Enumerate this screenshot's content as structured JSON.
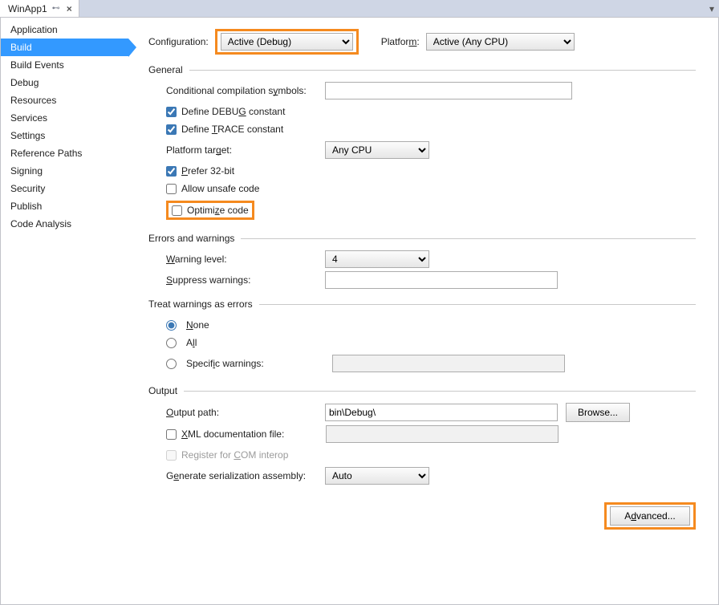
{
  "tab": {
    "title": "WinApp1"
  },
  "sidenav": {
    "items": [
      {
        "label": "Application",
        "selected": false
      },
      {
        "label": "Build",
        "selected": true
      },
      {
        "label": "Build Events",
        "selected": false
      },
      {
        "label": "Debug",
        "selected": false
      },
      {
        "label": "Resources",
        "selected": false
      },
      {
        "label": "Services",
        "selected": false
      },
      {
        "label": "Settings",
        "selected": false
      },
      {
        "label": "Reference Paths",
        "selected": false
      },
      {
        "label": "Signing",
        "selected": false
      },
      {
        "label": "Security",
        "selected": false
      },
      {
        "label": "Publish",
        "selected": false
      },
      {
        "label": "Code Analysis",
        "selected": false
      }
    ]
  },
  "top": {
    "configuration_label": "Configuration:",
    "configuration_value": "Active (Debug)",
    "platform_label": "Platform:",
    "platform_value": "Active (Any CPU)"
  },
  "general": {
    "header": "General",
    "cond_symbols_label": "Conditional compilation symbols:",
    "cond_symbols_value": "",
    "define_debug_label": "Define DEBUG constant",
    "define_debug_checked": true,
    "define_trace_label": "Define TRACE constant",
    "define_trace_checked": true,
    "platform_target_label": "Platform target:",
    "platform_target_value": "Any CPU",
    "prefer32_label": "Prefer 32-bit",
    "prefer32_checked": true,
    "allow_unsafe_label": "Allow unsafe code",
    "allow_unsafe_checked": false,
    "optimize_label": "Optimize code",
    "optimize_checked": false
  },
  "errors": {
    "header": "Errors and warnings",
    "warning_level_label": "Warning level:",
    "warning_level_value": "4",
    "suppress_label": "Suppress warnings:",
    "suppress_value": ""
  },
  "treat": {
    "header": "Treat warnings as errors",
    "none_label": "None",
    "all_label": "All",
    "specific_label": "Specific warnings:",
    "specific_value": "",
    "selected": "none"
  },
  "output": {
    "header": "Output",
    "output_path_label": "Output path:",
    "output_path_value": "bin\\Debug\\",
    "browse_label": "Browse...",
    "xml_doc_label": "XML documentation file:",
    "xml_doc_checked": false,
    "xml_doc_value": "",
    "register_com_label": "Register for COM interop",
    "register_com_checked": false,
    "gen_serial_label": "Generate serialization assembly:",
    "gen_serial_value": "Auto"
  },
  "advanced_label": "Advanced..."
}
